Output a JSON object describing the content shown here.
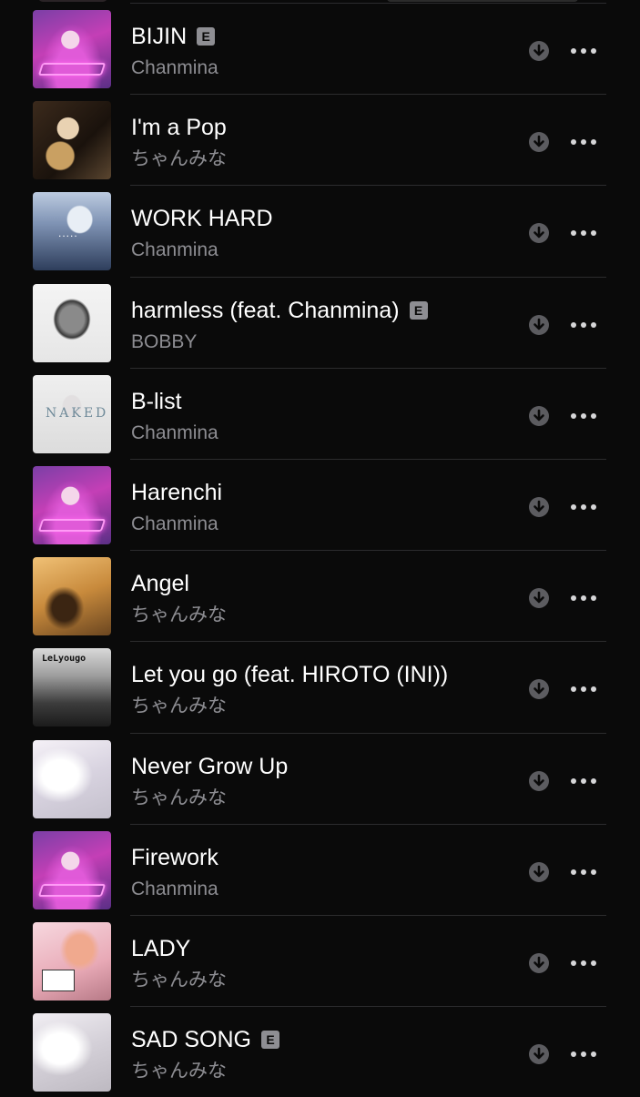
{
  "tracks": [
    {
      "title": "BIJIN",
      "artist": "Chanmina",
      "explicit": true,
      "explicit_label": "E",
      "art": "bijin"
    },
    {
      "title": "I'm a Pop",
      "artist": "ちゃんみな",
      "explicit": false,
      "art": "pop"
    },
    {
      "title": "WORK HARD",
      "artist": "Chanmina",
      "explicit": false,
      "art": "work",
      "art_text": "....."
    },
    {
      "title": "harmless (feat. Chanmina)",
      "artist": "BOBBY",
      "explicit": true,
      "explicit_label": "E",
      "art": "harmless"
    },
    {
      "title": "B-list",
      "artist": "Chanmina",
      "explicit": false,
      "art": "blist",
      "art_text": "NAKED"
    },
    {
      "title": "Harenchi",
      "artist": "Chanmina",
      "explicit": false,
      "art": "bijin"
    },
    {
      "title": "Angel",
      "artist": "ちゃんみな",
      "explicit": false,
      "art": "angel"
    },
    {
      "title": "Let you go (feat. HIROTO (INI))",
      "artist": "ちゃんみな",
      "explicit": false,
      "art": "letgo",
      "art_text": "LeLyougo"
    },
    {
      "title": "Never Grow Up",
      "artist": "ちゃんみな",
      "explicit": false,
      "art": "never"
    },
    {
      "title": "Firework",
      "artist": "Chanmina",
      "explicit": false,
      "art": "bijin"
    },
    {
      "title": "LADY",
      "artist": "ちゃんみな",
      "explicit": false,
      "art": "lady"
    },
    {
      "title": "SAD SONG",
      "artist": "ちゃんみな",
      "explicit": true,
      "explicit_label": "E",
      "art": "sad"
    }
  ],
  "icons": {
    "download": "download-icon",
    "more": "more-icon"
  },
  "colors": {
    "background": "#0a0a0a",
    "title": "#ffffff",
    "artist": "#8d8d92",
    "icon": "#5c5c60",
    "divider": "#2c2c2e"
  }
}
